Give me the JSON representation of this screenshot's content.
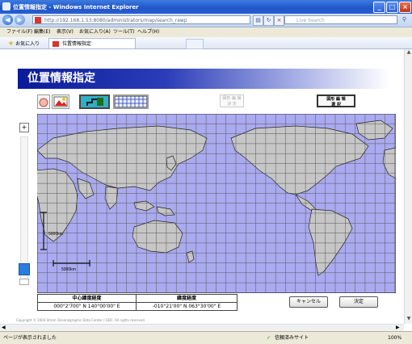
{
  "window": {
    "title": "位置情報指定 - Windows Internet Explorer",
    "min": "_",
    "max": "□",
    "close": "×"
  },
  "addressbar": {
    "url": "http://192.168.1.53:8080/administrators/map/search_rawp",
    "search_placeholder": "Live Search"
  },
  "menu": [
    "ファイル(F)",
    "編集(E)",
    "表示(V)",
    "お気に入り(A)",
    "ツール(T)",
    "ヘルプ(H)"
  ],
  "tabbar": {
    "favorites_label": "お気に入り",
    "tab_title": "位置情報指定"
  },
  "page": {
    "heading": "位置情報指定",
    "toolbar": {
      "btn_disabled": "図形 編 辑\n決 定",
      "btn_enabled": "図形 編 辑\n選 択"
    },
    "map": {
      "scale_vertical": "5000km",
      "scale_horizontal": "5000km"
    },
    "info_table": {
      "headers": [
        "中心緯度経度",
        "緯度経度"
      ],
      "values": [
        "000°2'700\" N   140°00'00\" E",
        "-010°21'00\" N   063°30'00\" E"
      ]
    },
    "buttons": {
      "cancel": "キャンセル",
      "ok": "決定"
    },
    "copyright": "Copyright © 2004 Strom Oceanographic Data Center / ODC. All rights reserved."
  },
  "statusbar": {
    "text": "ページが表示されました",
    "zone": "信頼済みサイト",
    "zoom": "100%"
  },
  "colors": {
    "ocean": "#aaaaf0",
    "land": "#c6c6c6",
    "grid": "#555555",
    "heading": "#0a1b9a"
  }
}
